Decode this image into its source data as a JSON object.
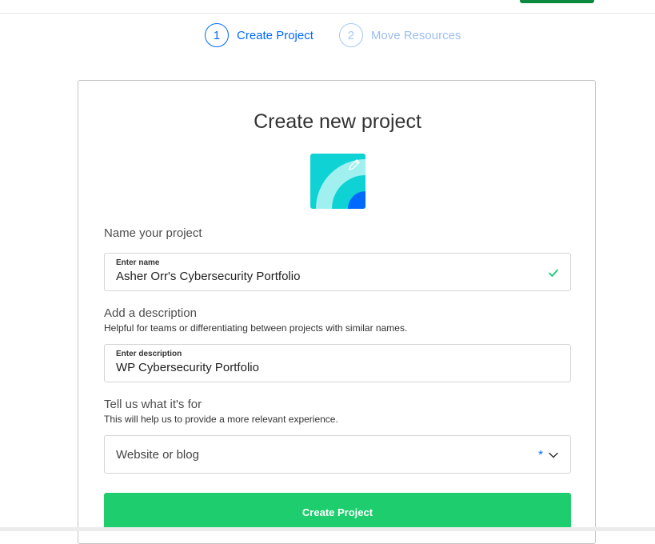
{
  "stepper": {
    "steps": [
      {
        "number": "1",
        "label": "Create Project",
        "state": "active"
      },
      {
        "number": "2",
        "label": "Move Resources",
        "state": "inactive"
      }
    ]
  },
  "card": {
    "title": "Create new project",
    "project_icon": "project-avatar-icon",
    "edit_icon": "pencil-icon"
  },
  "name_section": {
    "label": "Name your project",
    "field_label": "Enter name",
    "value": "Asher Orr's Cybersecurity Portfolio",
    "valid_icon": "check-icon"
  },
  "description_section": {
    "label": "Add a description",
    "help": "Helpful for teams or differentiating between projects with similar names.",
    "field_label": "Enter description",
    "value": "WP Cybersecurity Portfolio"
  },
  "purpose_section": {
    "label": "Tell us what it's for",
    "help": "This will help us to provide a more relevant experience.",
    "selected": "Website or blog",
    "required_marker": "*",
    "dropdown_icon": "chevron-down-icon"
  },
  "submit": {
    "label": "Create Project"
  },
  "colors": {
    "accent_blue": "#0069ff",
    "primary_green": "#1dcd6e",
    "valid_green": "#15cd72"
  }
}
